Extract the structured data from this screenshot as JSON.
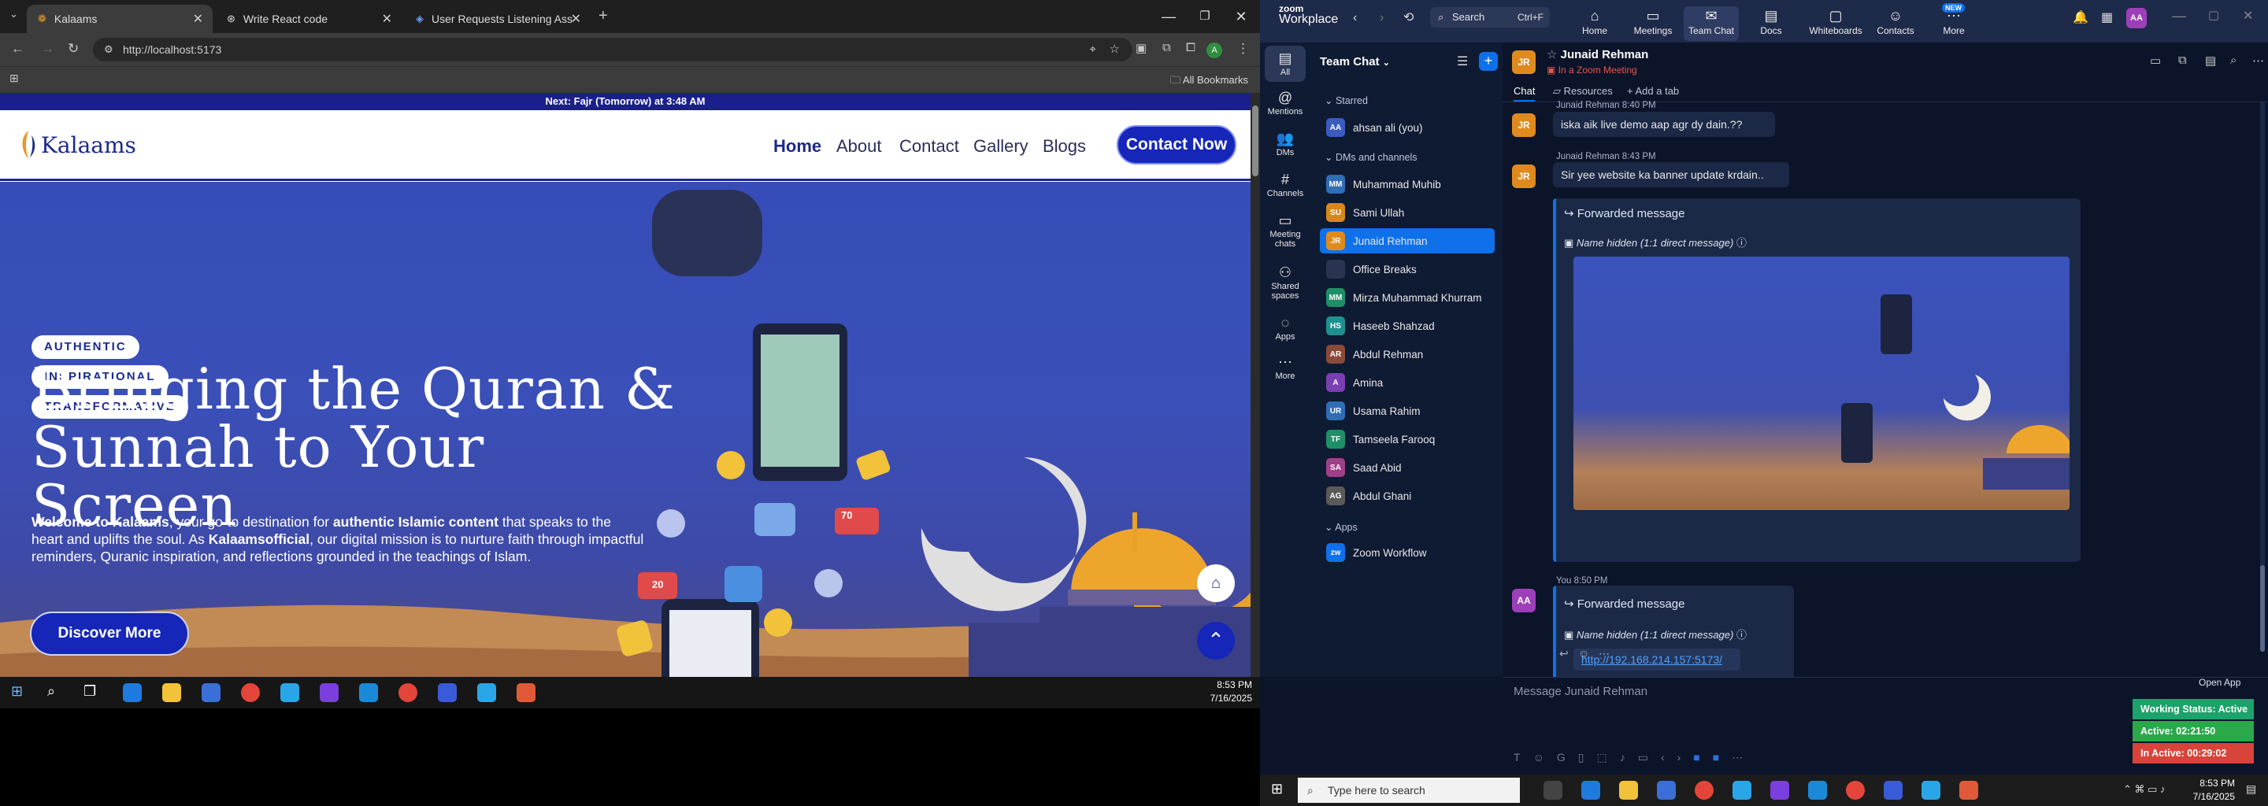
{
  "chrome": {
    "tabs": [
      {
        "title": "Kalaams"
      },
      {
        "title": "Write React code"
      },
      {
        "title": "User Requests Listening Assista"
      }
    ],
    "url": "http://localhost:5173",
    "bookmarks_label": "All Bookmarks"
  },
  "site": {
    "prayer_bar": "Next: Fajr (Tomorrow) at 3:48 AM",
    "logo": "Kalaams",
    "nav": [
      "Home",
      "About",
      "Contact",
      "Gallery",
      "Blogs"
    ],
    "contact_button": "Contact Now",
    "pills": [
      "AUTHENTIC",
      "INSPIRATIONAL",
      "TRANSFORMATIVE"
    ],
    "hero_title_line1": "Bringing the Quran &",
    "hero_title_line2": "Sunnah to Your Screen",
    "hero_text": {
      "p1": "Welcome to Kalaams",
      "p2": ", your go-to destination for ",
      "p3": "authentic Islamic content",
      "p4": " that speaks to the heart and uplifts the soul. As ",
      "p5": "Kalaamsofficial",
      "p6": ", our digital mission is to nurture faith through impactful reminders, Quranic inspiration, and reflections grounded in the teachings of Islam."
    },
    "discover_button": "Discover More",
    "badges": [
      "20",
      "70"
    ]
  },
  "left_taskbar": {
    "time": "8:53 PM",
    "date": "7/16/2025"
  },
  "zoom": {
    "brand_top": "zoom",
    "brand": "Workplace",
    "search": "Search",
    "search_shortcut": "Ctrl+F",
    "nav": [
      {
        "label": "Home",
        "icon": "home-icon"
      },
      {
        "label": "Meetings",
        "icon": "video-icon"
      },
      {
        "label": "Team Chat",
        "icon": "chat-icon"
      },
      {
        "label": "Docs",
        "icon": "docs-icon"
      },
      {
        "label": "Whiteboards",
        "icon": "whiteboard-icon"
      },
      {
        "label": "Contacts",
        "icon": "contacts-icon"
      },
      {
        "label": "More",
        "icon": "more-icon",
        "badge": "NEW"
      }
    ],
    "user_avatar": "AA",
    "rail": [
      "All",
      "Mentions",
      "DMs",
      "Channels",
      "Meeting chats",
      "Shared spaces",
      "Apps",
      "More"
    ],
    "sidebar": {
      "title": "Team Chat",
      "starred_label": "Starred",
      "starred": [
        {
          "name": "ahsan ali (you)",
          "initials": "AA",
          "color": "#3b5bbf"
        }
      ],
      "dms_label": "DMs and channels",
      "dms": [
        {
          "name": "Muhammad Muhib",
          "initials": "MM",
          "color": "#2f6db5"
        },
        {
          "name": "Sami Ullah",
          "initials": "SU",
          "color": "#d48a1a"
        },
        {
          "name": "Junaid Rehman",
          "initials": "JR",
          "color": "#e08a1e"
        },
        {
          "name": "Office Breaks",
          "initials": "",
          "color": "#2a3350"
        },
        {
          "name": "Mirza Muhammad Khurram",
          "initials": "MM",
          "color": "#1f8f6a"
        },
        {
          "name": "Haseeb Shahzad",
          "initials": "HS",
          "color": "#1f8f8f"
        },
        {
          "name": "Abdul Rehman",
          "initials": "AR",
          "color": "#8a4a3a"
        },
        {
          "name": "Amina",
          "initials": "A",
          "color": "#7a3fb0"
        },
        {
          "name": "Usama Rahim",
          "initials": "UR",
          "color": "#2f6db5"
        },
        {
          "name": "Tamseela Farooq",
          "initials": "TF",
          "color": "#1f8f6a"
        },
        {
          "name": "Saad Abid",
          "initials": "SA",
          "color": "#a13f8a"
        },
        {
          "name": "Abdul Ghani",
          "initials": "AG",
          "color": "#5a5a5a"
        }
      ],
      "apps_label": "Apps",
      "apps": [
        {
          "name": "Zoom Workflow",
          "initials": "zw",
          "color": "#0e71eb"
        }
      ]
    },
    "chat": {
      "contact": "Junaid Rehman",
      "contact_status": "In a Zoom Meeting",
      "tabs": [
        "Chat",
        "Resources",
        "Add a tab"
      ],
      "messages": [
        {
          "sender": "Junaid Rehman",
          "time": "8:40 PM",
          "text": "iska aik live demo aap agr dy dain.??"
        },
        {
          "sender": "Junaid Rehman",
          "time": "8:43 PM",
          "text": "Sir yee website ka banner update krdain.."
        }
      ],
      "forward_label": "Forwarded message",
      "hidden_label": "Name hidden (1:1 direct message)",
      "you_time": "You 8:50 PM",
      "link": "http://192.168.214.157:5173/",
      "compose_placeholder": "Message Junaid Rehman"
    },
    "open_app": "Open App",
    "status": {
      "working": "Working Status: Active",
      "active": "Active: 02:21:50",
      "inactive": "In Active: 00:29:02"
    }
  },
  "right_taskbar": {
    "search": "Type here to search",
    "time": "8:53 PM",
    "date": "7/16/2025"
  }
}
